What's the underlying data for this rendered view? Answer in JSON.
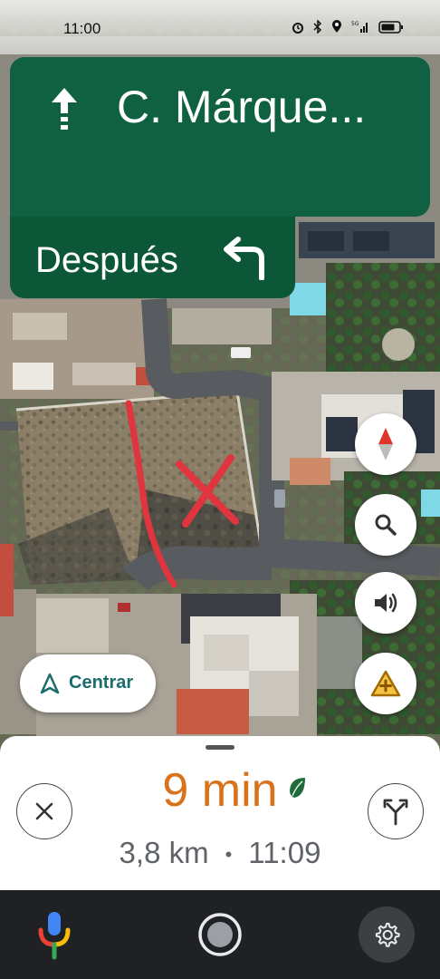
{
  "status_bar": {
    "time": "11:00",
    "icons": [
      "alarm-icon",
      "bluetooth-icon",
      "location-icon",
      "5g-signal-icon",
      "battery-icon"
    ]
  },
  "navigation": {
    "current_instruction": {
      "direction_icon": "straight-arrow-icon",
      "street": "C. Márque..."
    },
    "next_instruction": {
      "label": "Después",
      "direction_icon": "turn-left-icon"
    }
  },
  "map_controls": {
    "compass": "compass-icon",
    "search": "search-icon",
    "sound": "volume-icon",
    "report": "report-incident-icon"
  },
  "recenter": {
    "label": "Centrar",
    "icon": "navigation-arrow-icon"
  },
  "trip": {
    "duration": "9 min",
    "eco_icon": "leaf-icon",
    "distance": "3,8 km",
    "separator": "•",
    "arrival_time": "11:09"
  },
  "bottom_controls": {
    "close": "close-icon",
    "alternate_routes": "alternate-routes-icon"
  },
  "system_nav": {
    "assistant": "google-mic-icon",
    "home": "home-circle-icon",
    "settings": "gear-icon"
  },
  "colors": {
    "banner_primary": "#0f6142",
    "banner_secondary": "#0b5738",
    "eta_accent": "#d9731b",
    "recenter_text": "#1a6d6c",
    "annotation_red": "#e0353f"
  }
}
